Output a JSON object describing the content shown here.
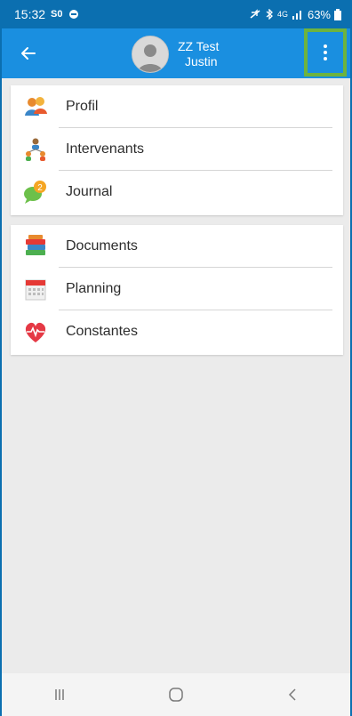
{
  "status_bar": {
    "time": "15:32",
    "battery": "63%",
    "left_badge": "S0",
    "network": "4G"
  },
  "header": {
    "name_line1": "ZZ Test",
    "name_line2": "Justin"
  },
  "menu_sections": [
    {
      "items": [
        {
          "label": "Profil",
          "icon": "profile-icon"
        },
        {
          "label": "Intervenants",
          "icon": "intervenants-icon"
        },
        {
          "label": "Journal",
          "icon": "journal-icon",
          "badge": "2"
        }
      ]
    },
    {
      "items": [
        {
          "label": "Documents",
          "icon": "documents-icon"
        },
        {
          "label": "Planning",
          "icon": "planning-icon"
        },
        {
          "label": "Constantes",
          "icon": "constantes-icon"
        }
      ]
    }
  ],
  "colors": {
    "status_bar": "#0b6fb0",
    "app_bar": "#1a8fe0",
    "highlight_border": "#6db33f",
    "background": "#ebebeb"
  }
}
